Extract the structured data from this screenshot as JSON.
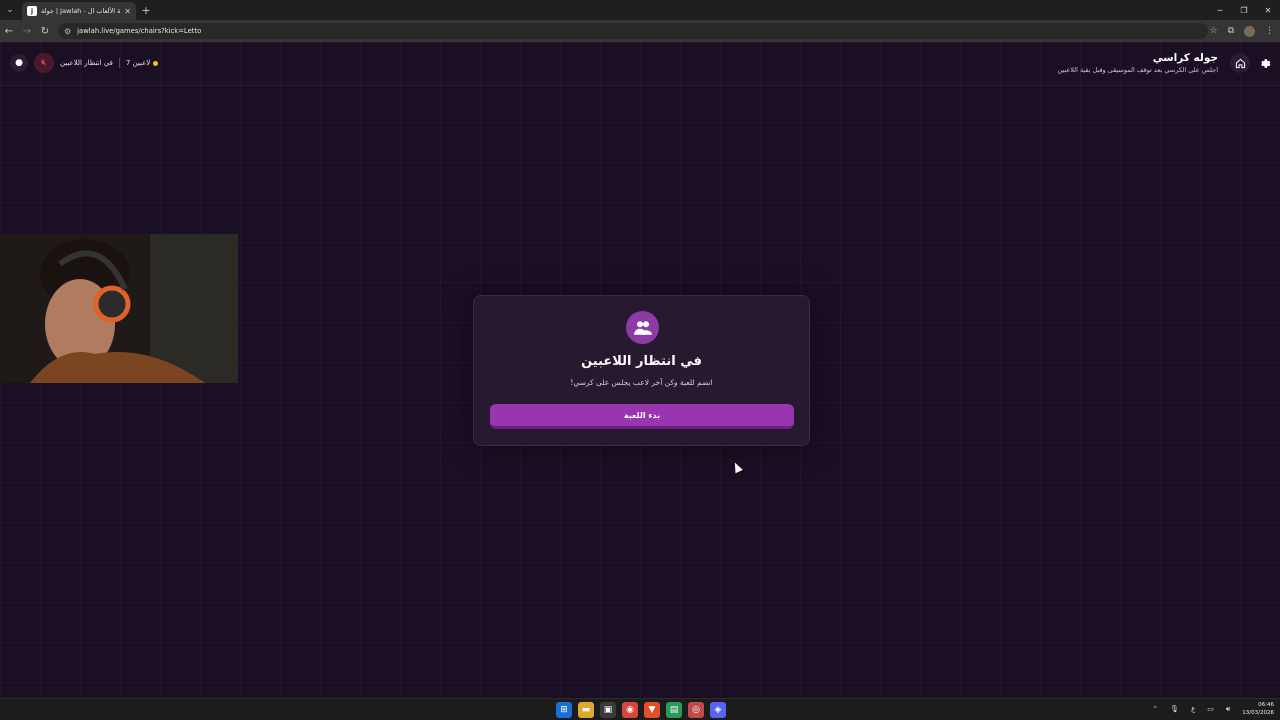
{
  "browser": {
    "tab_title": "جولة | Jawlah - منصة الألعاب ال...",
    "tab_favicon": "jawlah-logo-icon",
    "url": "jawlah.live/games/chairs?kick=Letto"
  },
  "topbar": {
    "game_title": "جوله كراسي",
    "game_subtitle": "اجلس على الكرسي بعد توقف الموسيقى وقبل بقية اللاعبين",
    "status_text": "في انتظار اللاعبين",
    "players_count_text": "7 لاعبين",
    "status_dot_color": "#f5c518",
    "sound_state": "muted"
  },
  "card": {
    "title": "في انتظار اللاعبين",
    "subtitle": "انضم للعبة وكن آخر لاعب يجلس على كرسي!",
    "start_button_label": "بدء اللعبة",
    "icon": "users-icon",
    "accent_color": "#9a35b0"
  },
  "taskbar": {
    "lang": "ع",
    "time": "06:46",
    "date": "13/03/2026"
  }
}
